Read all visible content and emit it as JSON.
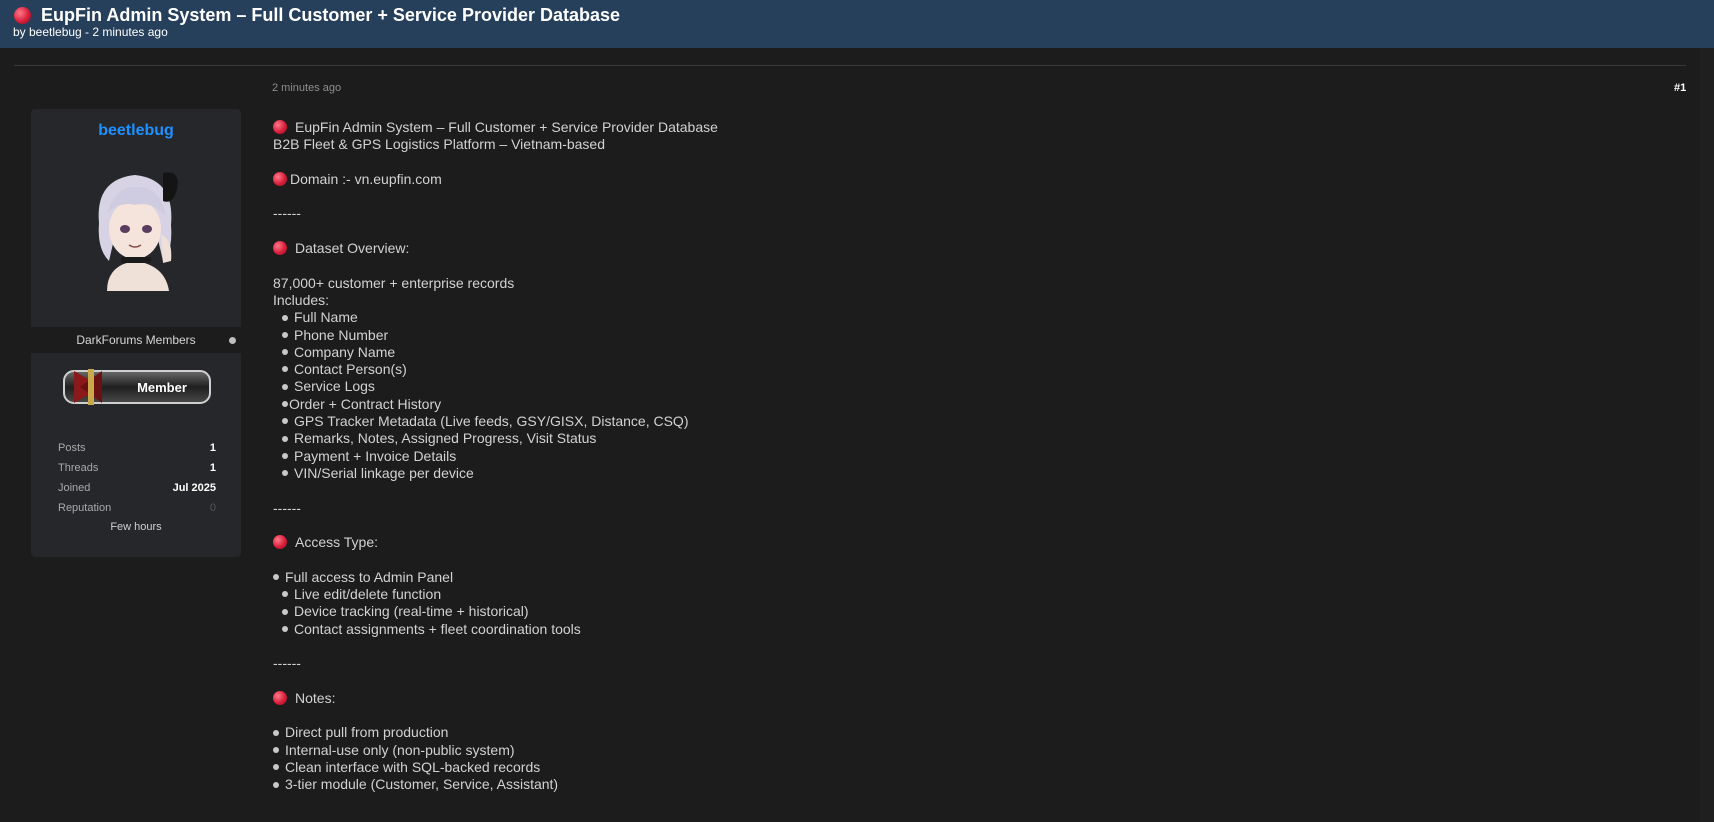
{
  "header": {
    "title": "EupFin Admin System – Full Customer + Service Provider Database",
    "byline": "by beetlebug - 2 minutes ago"
  },
  "post": {
    "date": "2 minutes ago",
    "number": "#1"
  },
  "user": {
    "name": "beetlebug",
    "group": "DarkForums Members",
    "badge": "Member",
    "stats": [
      {
        "label": "Posts",
        "value": "1"
      },
      {
        "label": "Threads",
        "value": "1"
      },
      {
        "label": "Joined",
        "value": "Jul 2025"
      },
      {
        "label": "Reputation",
        "value": "0"
      }
    ],
    "activity": "Few hours"
  },
  "content": {
    "title_line": "EupFin Admin System – Full Customer + Service Provider Database",
    "subtitle": "B2B Fleet & GPS Logistics Platform – Vietnam-based",
    "domain": "Domain :- vn.eupfin.com",
    "separator": "------",
    "overview_heading": "Dataset Overview:",
    "records": "87,000+ customer + enterprise records",
    "includes": "Includes:",
    "include_items": [
      "Full Name",
      "Phone Number",
      "Company Name",
      "Contact Person(s)",
      "Service Logs",
      "Order + Contract History",
      "GPS Tracker Metadata (Live feeds, GSY/GISX, Distance, CSQ)",
      "Remarks, Notes, Assigned Progress, Visit Status",
      "Payment + Invoice Details",
      "VIN/Serial linkage per device"
    ],
    "access_heading": "Access Type:",
    "access_items": [
      "Full access to Admin Panel",
      "Live edit/delete function",
      "Device tracking (real-time + historical)",
      "Contact assignments + fleet coordination tools"
    ],
    "notes_heading": "Notes:",
    "notes_items": [
      "Direct pull from production",
      "Internal-use only (non-public system)",
      "Clean interface with SQL-backed records",
      "3-tier module (Customer, Service, Assistant)"
    ]
  }
}
